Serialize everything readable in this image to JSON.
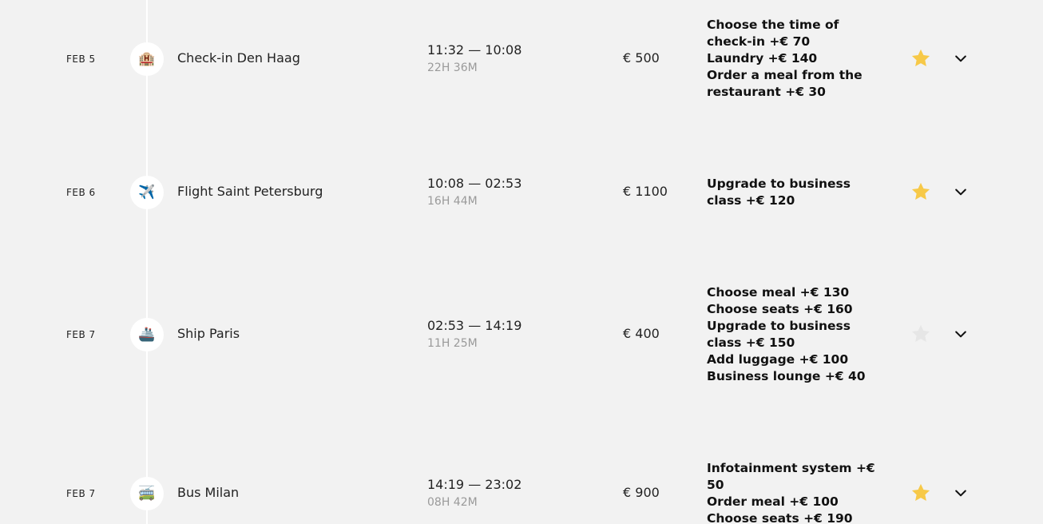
{
  "events": [
    {
      "date": "FEB 5",
      "icon": "hotel-icon",
      "icon_glyph": "🏨",
      "title": "Check-in Den Haag",
      "time": "11:32 — 10:08",
      "duration": "22H 36M",
      "price": "€ 500",
      "favorite": true,
      "options": [
        "Choose the time of check-in +€  70",
        "Laundry +€  140",
        "Order a meal from the restaurant +€  30"
      ]
    },
    {
      "date": "FEB 6",
      "icon": "airplane-icon",
      "icon_glyph": "✈️",
      "title": "Flight Saint Petersburg",
      "time": "10:08 — 02:53",
      "duration": "16H 44M",
      "price": "€ 1100",
      "favorite": true,
      "options": [
        "Upgrade to business class +€  120"
      ]
    },
    {
      "date": "FEB 7",
      "icon": "ship-icon",
      "icon_glyph": "🚢",
      "title": "Ship Paris",
      "time": "02:53 — 14:19",
      "duration": "11H 25M",
      "price": "€ 400",
      "favorite": false,
      "options": [
        "Choose meal +€  130",
        "Choose seats +€  160",
        "Upgrade to business class +€  150",
        "Add luggage +€  100",
        "Business lounge +€  40"
      ]
    },
    {
      "date": "FEB 7",
      "icon": "bus-icon",
      "icon_glyph": "🚎",
      "title": "Bus Milan",
      "time": "14:19 — 23:02",
      "duration": "08H 42M",
      "price": "€ 900",
      "favorite": true,
      "options": [
        "Infotainment system +€  50",
        "Order meal +€  100",
        "Choose seats +€  190"
      ]
    }
  ],
  "colors": {
    "background": "#f2f2f2",
    "star_active": "#f7c948",
    "star_inactive": "#e6e6e6",
    "muted_text": "#9a9a9a"
  }
}
